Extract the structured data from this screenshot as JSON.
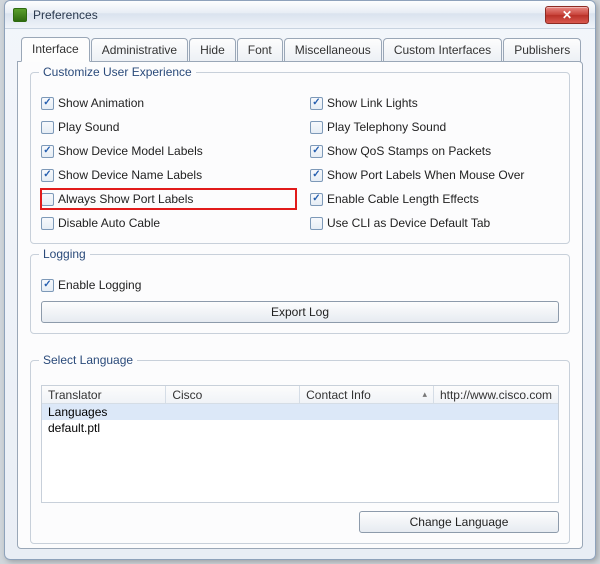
{
  "window": {
    "title": "Preferences"
  },
  "tabs": [
    {
      "label": "Interface"
    },
    {
      "label": "Administrative"
    },
    {
      "label": "Hide"
    },
    {
      "label": "Font"
    },
    {
      "label": "Miscellaneous"
    },
    {
      "label": "Custom Interfaces"
    },
    {
      "label": "Publishers"
    }
  ],
  "groups": {
    "customize": {
      "legend": "Customize User Experience",
      "left": [
        {
          "label": "Show Animation",
          "checked": true
        },
        {
          "label": "Play Sound",
          "checked": false
        },
        {
          "label": "Show Device Model Labels",
          "checked": true
        },
        {
          "label": "Show Device Name Labels",
          "checked": true
        },
        {
          "label": "Always Show Port Labels",
          "checked": false,
          "highlight": true
        },
        {
          "label": "Disable Auto Cable",
          "checked": false
        }
      ],
      "right": [
        {
          "label": "Show Link Lights",
          "checked": true
        },
        {
          "label": "Play Telephony Sound",
          "checked": false
        },
        {
          "label": "Show QoS Stamps on Packets",
          "checked": true
        },
        {
          "label": "Show Port Labels When Mouse Over",
          "checked": true
        },
        {
          "label": "Enable Cable Length Effects",
          "checked": true
        },
        {
          "label": "Use CLI as Device Default Tab",
          "checked": false
        }
      ]
    },
    "logging": {
      "legend": "Logging",
      "enable_label": "Enable Logging",
      "enable_checked": true,
      "export_button": "Export Log"
    },
    "language": {
      "legend": "Select Language",
      "columns": {
        "translator": "Translator",
        "cisco": "Cisco",
        "contact": "Contact Info",
        "url": "http://www.cisco.com"
      },
      "rows": [
        {
          "translator": "Languages",
          "selected": true
        },
        {
          "translator": "default.ptl",
          "selected": false
        }
      ],
      "change_button": "Change Language"
    }
  }
}
